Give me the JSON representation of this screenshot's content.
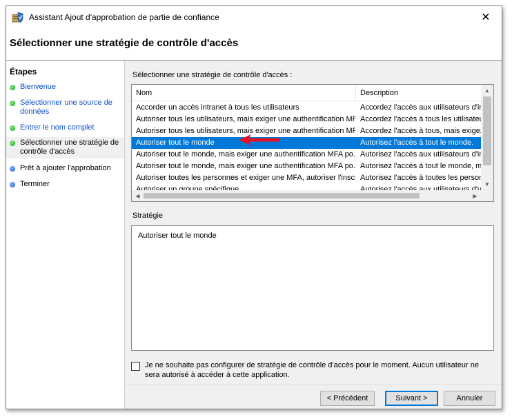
{
  "window": {
    "title": "Assistant Ajout d'approbation de partie de confiance",
    "close_glyph": "✕"
  },
  "page": {
    "title": "Sélectionner une stratégie de contrôle d'accès"
  },
  "sidebar": {
    "title": "Étapes",
    "steps": [
      {
        "label": "Bienvenue",
        "state": "done"
      },
      {
        "label": "Sélectionner une source de données",
        "state": "done"
      },
      {
        "label": "Entrer le nom complet",
        "state": "done"
      },
      {
        "label": "Sélectionner une stratégie de contrôle d'accès",
        "state": "current"
      },
      {
        "label": "Prêt à ajouter l'approbation",
        "state": "pending"
      },
      {
        "label": "Terminer",
        "state": "pending"
      }
    ]
  },
  "policy_list": {
    "label": "Sélectionner une stratégie de contrôle d'accès :",
    "columns": {
      "name": "Nom",
      "description": "Description"
    },
    "rows": [
      {
        "name": "Accorder un accès intranet à tous les utilisateurs",
        "description": "Accordez l'accès aux utilisateurs d'in"
      },
      {
        "name": "Autoriser tous les utilisateurs, mais exiger une authentification MFA",
        "description": "Accordez l'accès à tous les utilisateu"
      },
      {
        "name": "Autoriser tous les utilisateurs, mais exiger une authentification MF...",
        "description": "Accordez l'accès à tous, mais exigez"
      },
      {
        "name": "Autoriser tout le monde",
        "description": "Autorisez l'accès à tout le monde.",
        "selected": true
      },
      {
        "name": "Autoriser tout le monde, mais exiger une authentification MFA po...",
        "description": "Autorisez l'accès aux utilisateurs d'int"
      },
      {
        "name": "Autoriser tout le monde, mais exiger une authentification MFA po...",
        "description": "Autorisez l'accès à tout le monde, ma"
      },
      {
        "name": "Autoriser toutes les personnes et exiger une MFA, autoriser l'inscr...",
        "description": "Autorisez l'accès à toutes les person"
      },
      {
        "name": "Autoriser un groupe spécifique",
        "description": "Autorisez l'accès aux utilisateurs d'u"
      }
    ]
  },
  "strategy": {
    "label": "Stratégie",
    "text": "Autoriser tout le monde"
  },
  "opt_out": {
    "checked": false,
    "label": "Je ne souhaite pas configurer de stratégie de contrôle d'accès pour le moment. Aucun utilisateur ne sera autorisé à accéder à cette application."
  },
  "buttons": {
    "previous": "< Précédent",
    "next": "Suivant >",
    "cancel": "Annuler"
  },
  "colors": {
    "selection": "#0078d7",
    "link": "#0b50c8",
    "annotation_arrow": "#e81123"
  }
}
